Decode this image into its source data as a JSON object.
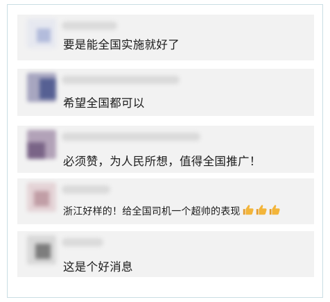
{
  "comments": [
    {
      "text": "要是能全国实施就好了",
      "avatar_colors": [
        "#d4d7e6",
        "#b9c1dd",
        "#e3e5ee",
        "#c8cce0"
      ]
    },
    {
      "text": "希望全国都可以",
      "avatar_colors": [
        "#8d8cae",
        "#5b6294",
        "#b3b0c6",
        "#71759f"
      ]
    },
    {
      "text": "必须赞，为人民所想，值得全国推广！",
      "avatar_colors": [
        "#9b8aa3",
        "#7d6689",
        "#b9a9be",
        "#8c7a97"
      ]
    },
    {
      "text": "浙江好样的！给全国司机一个超帅的表现",
      "emoji": [
        "thumbs-up",
        "thumbs-up",
        "thumbs-up"
      ],
      "avatar_colors": [
        "#c9a6ad",
        "#b48f99",
        "#d9c0c5",
        "#bd9aa3"
      ]
    },
    {
      "text": "这是个好消息",
      "avatar_colors": [
        "#9e9e9e",
        "#7a7a7a",
        "#c4c4c4",
        "#8c8c8c"
      ]
    }
  ],
  "colors": {
    "card_bg": "#f2f2f2",
    "frame_border": "#c9dde3",
    "thumb": "#f3b53a"
  }
}
